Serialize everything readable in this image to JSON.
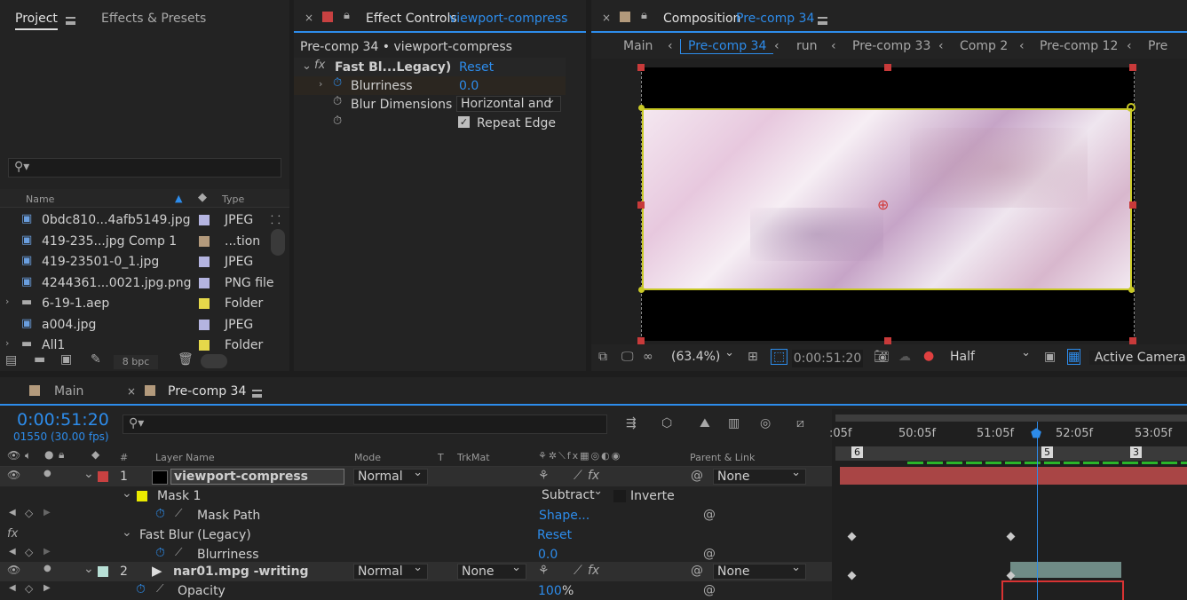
{
  "project_panel": {
    "tabs": [
      "Project",
      "Effects & Presets"
    ],
    "search_placeholder": "",
    "col_name": "Name",
    "col_type": "Type",
    "items": [
      {
        "name": "0bdc810...4afb5149.jpg",
        "type": "JPEG",
        "color": "#b4b4e0"
      },
      {
        "name": "419-235...jpg Comp 1",
        "type": "...tion",
        "color": "#b39a7c"
      },
      {
        "name": "419-23501-0_1.jpg",
        "type": "JPEG",
        "color": "#b4b4e0"
      },
      {
        "name": "4244361...0021.jpg.png",
        "type": "PNG file",
        "color": "#b4b4e0"
      },
      {
        "name": "6-19-1.aep",
        "type": "Folder",
        "color": "#e5d84a"
      },
      {
        "name": "a004.jpg",
        "type": "JPEG",
        "color": "#b4b4e0"
      },
      {
        "name": "All1",
        "type": "Folder",
        "color": "#e5d84a"
      }
    ],
    "bpc": "8 bpc"
  },
  "effect_controls": {
    "tab_prefix": "Effect Controls",
    "tab_layer": "viewport-compress",
    "breadcrumb": "Pre-comp 34 • viewport-compress",
    "effect_name": "Fast Bl...Legacy)",
    "reset": "Reset",
    "blurriness_label": "Blurriness",
    "blurriness_value": "0.0",
    "blur_dim_label": "Blur Dimensions",
    "blur_dim_value": "Horizontal and",
    "repeat_edge": "Repeat Edge"
  },
  "composition": {
    "tab_prefix": "Composition",
    "tab_name": "Pre-comp 34",
    "nav": [
      "Main",
      "Pre-comp 34",
      "run",
      "Pre-comp 33",
      "Comp 2",
      "Pre-comp 12",
      "Pre"
    ],
    "zoom": "(63.4%)",
    "timecode": "0:00:51:20",
    "resolution": "Half",
    "camera": "Active Camera"
  },
  "timeline": {
    "tabs": [
      "Main",
      "Pre-comp 34"
    ],
    "timecode": "0:00:51:20",
    "frames": "01550 (30.00 fps)",
    "col_headers": {
      "layer_name": "Layer Name",
      "mode": "Mode",
      "t": "T",
      "trkmat": "TrkMat",
      "parent": "Parent & Link"
    },
    "ruler": [
      ":05f",
      "50:05f",
      "51:05f",
      "52:05f",
      "53:05f"
    ],
    "markers": [
      "6",
      "5",
      "3"
    ],
    "layers": [
      {
        "num": "1",
        "name": "viewport-compress",
        "mode": "Normal",
        "parent": "None"
      },
      {
        "num": "2",
        "name": "nar01.mpg -writing",
        "mode": "Normal",
        "trkmat": "None",
        "parent": "None"
      }
    ],
    "mask_name": "Mask 1",
    "mask_mode": "Subtract",
    "inverted": "Inverte",
    "mask_path": "Mask Path",
    "mask_path_value": "Shape...",
    "effect_name": "Fast Blur (Legacy)",
    "effect_reset": "Reset",
    "blurriness": "Blurriness",
    "blurriness_value": "0.0",
    "opacity": "Opacity",
    "opacity_value": "100",
    "opacity_unit": "%"
  }
}
